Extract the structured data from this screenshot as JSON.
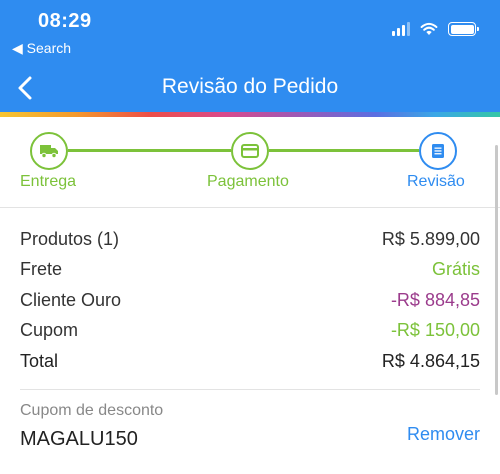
{
  "status_bar": {
    "time": "08:29",
    "back_app_label": "◀ Search",
    "icons": [
      "signal-icon",
      "wifi-icon",
      "battery-icon"
    ]
  },
  "header": {
    "title": "Revisão do Pedido",
    "back_icon": "chevron-left-icon",
    "background": "#2f8cf0"
  },
  "steps": [
    {
      "label": "Entrega",
      "icon": "truck-icon",
      "state": "done"
    },
    {
      "label": "Pagamento",
      "icon": "credit-card-icon",
      "state": "done"
    },
    {
      "label": "Revisão",
      "icon": "receipt-icon",
      "state": "current"
    }
  ],
  "summary": {
    "products": {
      "label": "Produtos (1)",
      "value": "R$ 5.899,00"
    },
    "shipping": {
      "label": "Frete",
      "value": "Grátis"
    },
    "gold_client": {
      "label": "Cliente Ouro",
      "value": "-R$ 884,85"
    },
    "coupon": {
      "label": "Cupom",
      "value": "-R$ 150,00"
    },
    "total": {
      "label": "Total",
      "value": "R$ 4.864,15"
    }
  },
  "coupon_section": {
    "label": "Cupom de desconto",
    "code": "MAGALU150",
    "remove_label": "Remover"
  },
  "colors": {
    "primary": "#2f8cf0",
    "success": "#7cc23a",
    "discount": "#9b3c8c"
  }
}
